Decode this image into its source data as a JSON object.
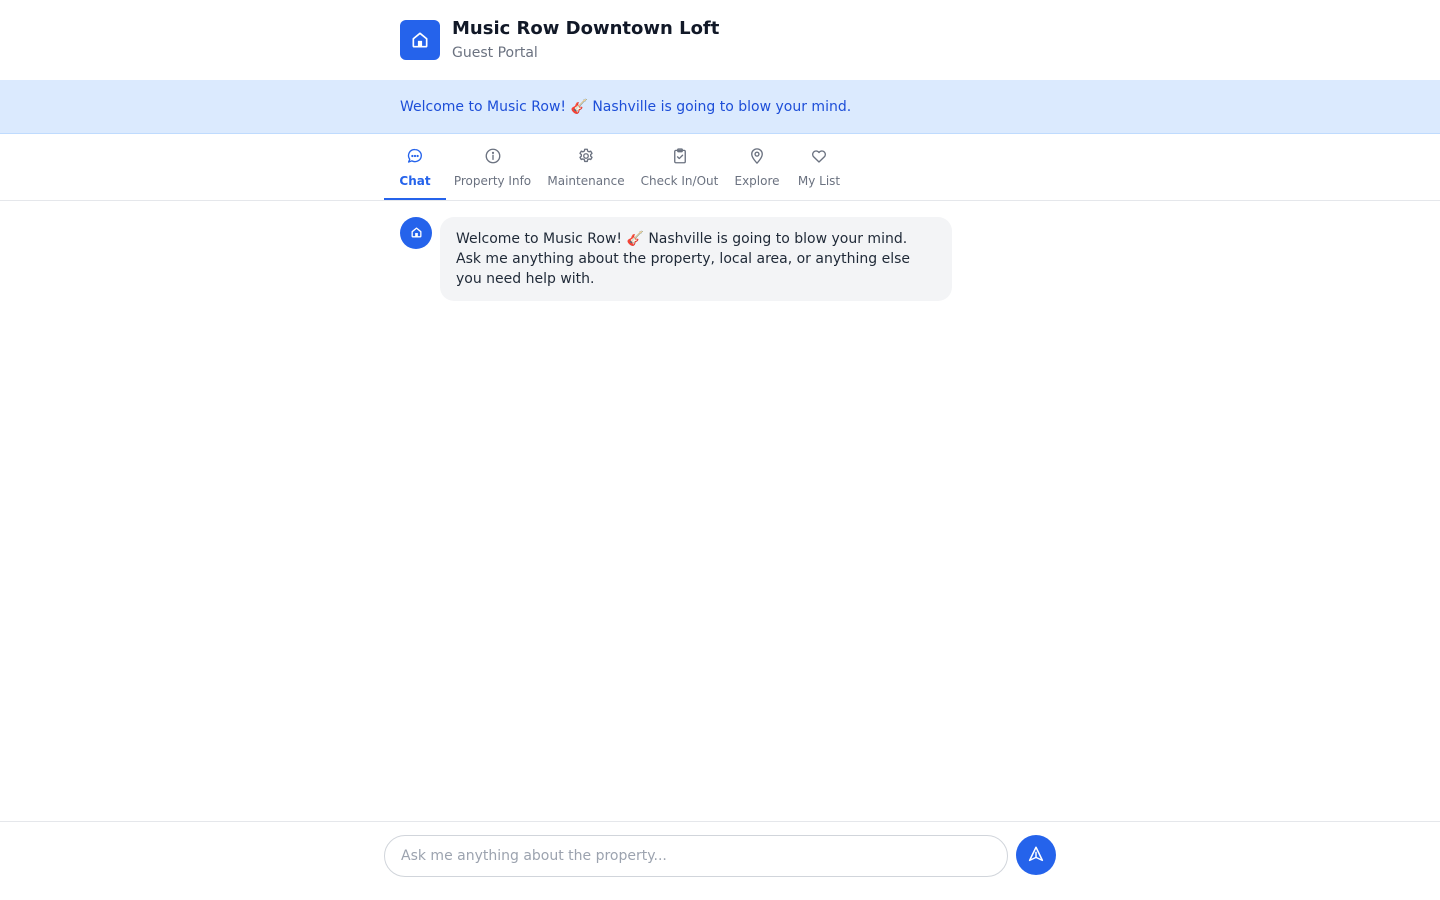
{
  "header": {
    "title": "Music Row Downtown Loft",
    "subtitle": "Guest Portal",
    "logo_icon": "home-icon"
  },
  "banner": {
    "text": "Welcome to Music Row! 🎸 Nashville is going to blow your mind."
  },
  "tabs": [
    {
      "label": "Chat",
      "icon": "chat-bubble-icon",
      "active": true
    },
    {
      "label": "Property Info",
      "icon": "info-icon",
      "active": false
    },
    {
      "label": "Maintenance",
      "icon": "gear-icon",
      "active": false
    },
    {
      "label": "Check In/Out",
      "icon": "clipboard-check-icon",
      "active": false
    },
    {
      "label": "Explore",
      "icon": "map-pin-icon",
      "active": false
    },
    {
      "label": "My List",
      "icon": "heart-icon",
      "active": false
    }
  ],
  "chat": {
    "messages": [
      {
        "sender": "assistant",
        "avatar_icon": "home-icon",
        "text": "Welcome to Music Row! 🎸 Nashville is going to blow your mind. Ask me anything about the property, local area, or anything else you need help with."
      }
    ]
  },
  "composer": {
    "placeholder": "Ask me anything about the property...",
    "value": "",
    "send_icon": "send-icon"
  },
  "colors": {
    "accent": "#2563eb",
    "banner_bg": "#dbeafe",
    "banner_text": "#1d4ed8",
    "bubble_bg": "#f3f4f6"
  }
}
